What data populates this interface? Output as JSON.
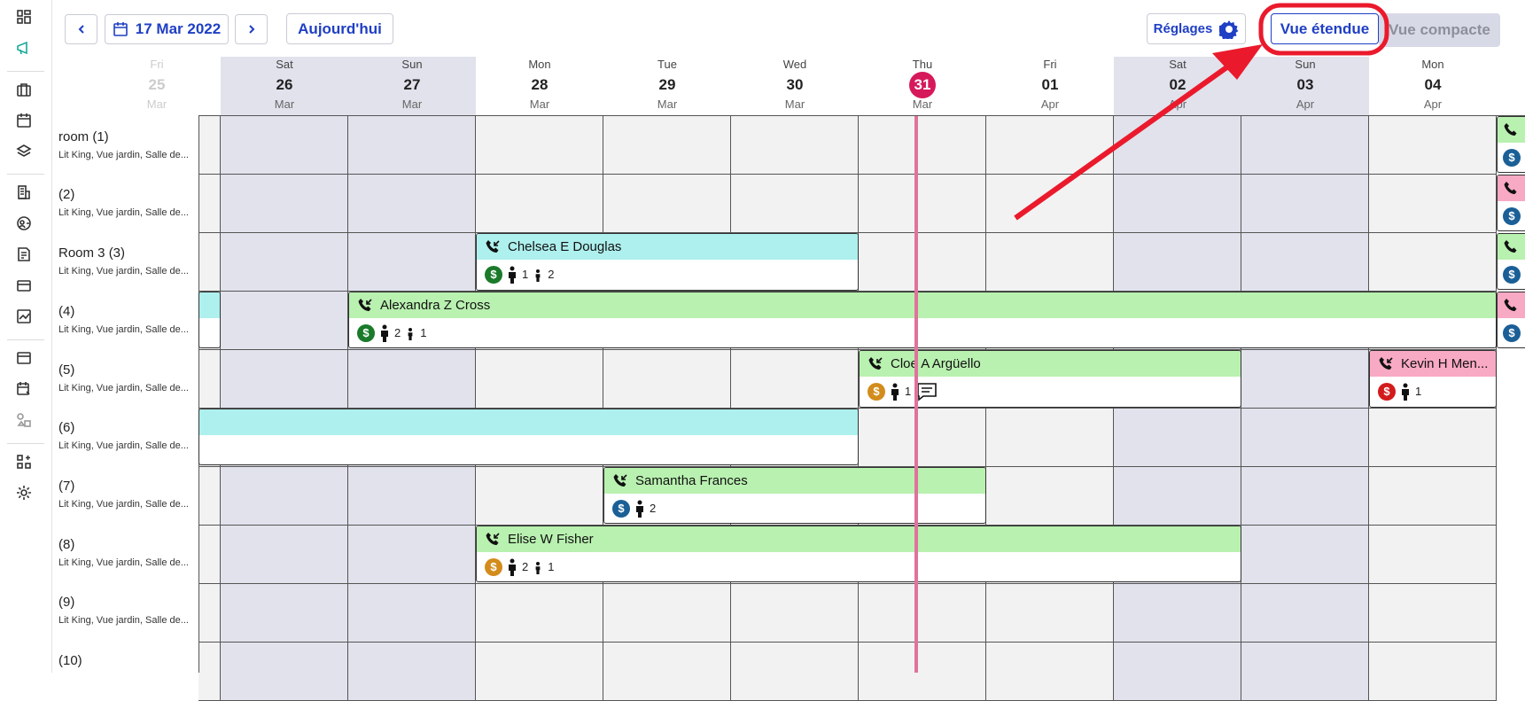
{
  "toolbar": {
    "date_label": "17 Mar 2022",
    "today_label": "Aujourd'hui",
    "settings_label": "Réglages",
    "expanded_view_label": "Vue étendue",
    "compact_view_label": "Vue compacte"
  },
  "days": [
    {
      "name": "Fri",
      "num": "25",
      "month": "Mar",
      "kind": "faded"
    },
    {
      "name": "Sat",
      "num": "26",
      "month": "Mar",
      "kind": "weekend"
    },
    {
      "name": "Sun",
      "num": "27",
      "month": "Mar",
      "kind": "weekend"
    },
    {
      "name": "Mon",
      "num": "28",
      "month": "Mar",
      "kind": "weekday"
    },
    {
      "name": "Tue",
      "num": "29",
      "month": "Mar",
      "kind": "weekday"
    },
    {
      "name": "Wed",
      "num": "30",
      "month": "Mar",
      "kind": "weekday"
    },
    {
      "name": "Thu",
      "num": "31",
      "month": "Mar",
      "kind": "today"
    },
    {
      "name": "Fri",
      "num": "01",
      "month": "Apr",
      "kind": "weekday"
    },
    {
      "name": "Sat",
      "num": "02",
      "month": "Apr",
      "kind": "weekend"
    },
    {
      "name": "Sun",
      "num": "03",
      "month": "Apr",
      "kind": "weekend"
    },
    {
      "name": "Mon",
      "num": "04",
      "month": "Apr",
      "kind": "weekday"
    }
  ],
  "rooms": [
    {
      "name": "room (1)",
      "desc": "Lit King, Vue jardin, Salle de..."
    },
    {
      "name": "(2)",
      "desc": "Lit King, Vue jardin, Salle de..."
    },
    {
      "name": "Room 3 (3)",
      "desc": "Lit King, Vue jardin, Salle de..."
    },
    {
      "name": "(4)",
      "desc": "Lit King, Vue jardin, Salle de..."
    },
    {
      "name": "(5)",
      "desc": "Lit King, Vue jardin, Salle de..."
    },
    {
      "name": "(6)",
      "desc": "Lit King, Vue jardin, Salle de..."
    },
    {
      "name": "(7)",
      "desc": "Lit King, Vue jardin, Salle de..."
    },
    {
      "name": "(8)",
      "desc": "Lit King, Vue jardin, Salle de..."
    },
    {
      "name": "(9)",
      "desc": "Lit King, Vue jardin, Salle de..."
    },
    {
      "name": "(10)",
      "desc": ""
    }
  ],
  "bookings": [
    {
      "guest": "Chelsea E Douglas",
      "adults": "1",
      "children": "2",
      "pay": "green"
    },
    {
      "guest": "Alexandra Z Cross",
      "adults": "2",
      "children": "1",
      "pay": "green"
    },
    {
      "guest": "Cloe A Argüello",
      "adults": "1",
      "children": "",
      "pay": "orange"
    },
    {
      "guest": "Kevin H Men...",
      "adults": "1",
      "children": "",
      "pay": "red"
    },
    {
      "guest": "Samantha Frances",
      "adults": "2",
      "children": "",
      "pay": "blue"
    },
    {
      "guest": "Elise W Fisher",
      "adults": "2",
      "children": "1",
      "pay": "orange"
    }
  ],
  "colors": {
    "accent": "#1f3fc4",
    "today": "#d6195a",
    "booking_green": "#b9f1b0",
    "booking_cyan": "#aef0ee",
    "booking_pink": "#f8a9c4",
    "pay_green": "#1a7a2a",
    "pay_orange": "#d38c1c",
    "pay_red": "#d21b1b",
    "pay_blue": "#1a5f96",
    "annotation": "#ea1a2c"
  }
}
